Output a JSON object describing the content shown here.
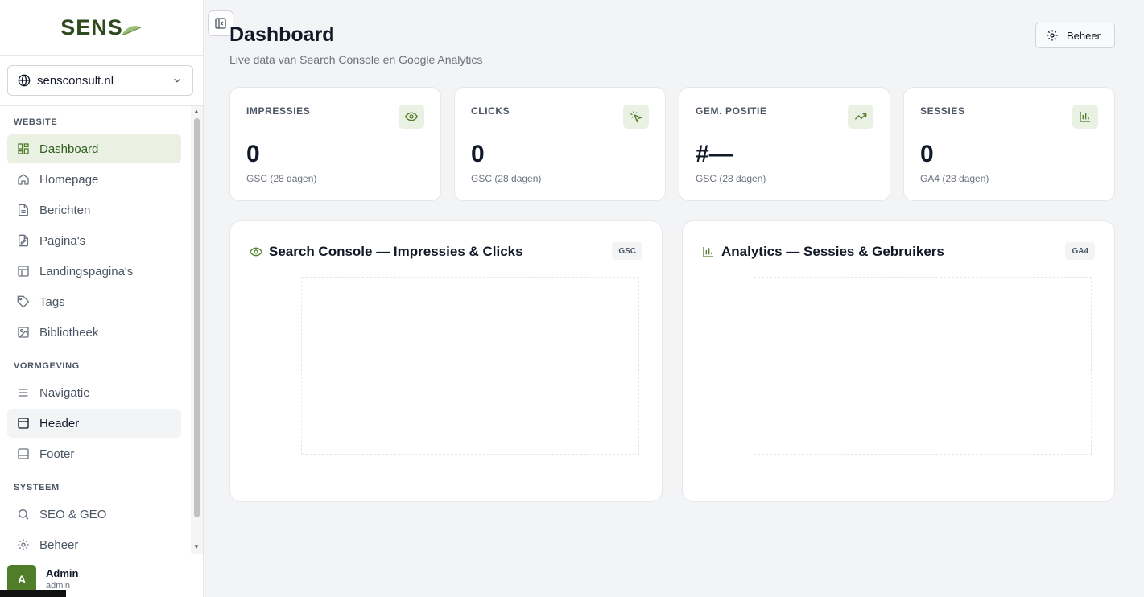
{
  "brand": {
    "logo_text": "SENS",
    "accent": "#4f7d2a",
    "active_bg": "#eaf1e3"
  },
  "site_selector": {
    "value": "sensconsult.nl"
  },
  "nav": {
    "sections": [
      {
        "title": "WEBSITE",
        "items": [
          {
            "label": "Dashboard",
            "icon": "layout-grid-icon",
            "state": "active"
          },
          {
            "label": "Homepage",
            "icon": "home-icon"
          },
          {
            "label": "Berichten",
            "icon": "file-text-icon"
          },
          {
            "label": "Pagina's",
            "icon": "file-edit-icon"
          },
          {
            "label": "Landingspagina's",
            "icon": "layout-icon"
          },
          {
            "label": "Tags",
            "icon": "tag-icon"
          },
          {
            "label": "Bibliotheek",
            "icon": "image-icon"
          }
        ]
      },
      {
        "title": "VORMGEVING",
        "items": [
          {
            "label": "Navigatie",
            "icon": "menu-icon"
          },
          {
            "label": "Header",
            "icon": "panel-top-icon",
            "state": "hover"
          },
          {
            "label": "Footer",
            "icon": "panel-bottom-icon"
          }
        ]
      },
      {
        "title": "SYSTEEM",
        "items": [
          {
            "label": "SEO & GEO",
            "icon": "search-icon"
          },
          {
            "label": "Beheer",
            "icon": "gear-icon"
          }
        ]
      }
    ]
  },
  "user": {
    "initial": "A",
    "name": "Admin",
    "role": "admin"
  },
  "header": {
    "title": "Dashboard",
    "subtitle": "Live data van Search Console en Google Analytics",
    "manage_button": "Beheer"
  },
  "stats": [
    {
      "label": "IMPRESSIES",
      "value": "0",
      "note": "GSC (28 dagen)",
      "icon": "eye-icon"
    },
    {
      "label": "CLICKS",
      "value": "0",
      "note": "GSC (28 dagen)",
      "icon": "mouse-click-icon"
    },
    {
      "label": "GEM. POSITIE",
      "value": "#—",
      "note": "GSC (28 dagen)",
      "icon": "trending-up-icon"
    },
    {
      "label": "SESSIES",
      "value": "0",
      "note": "GA4 (28 dagen)",
      "icon": "bar-chart-icon"
    }
  ],
  "charts": [
    {
      "title": "Search Console — Impressies & Clicks",
      "badge": "GSC",
      "icon": "eye-icon"
    },
    {
      "title": "Analytics — Sessies & Gebruikers",
      "badge": "GA4",
      "icon": "bar-chart-icon"
    }
  ]
}
